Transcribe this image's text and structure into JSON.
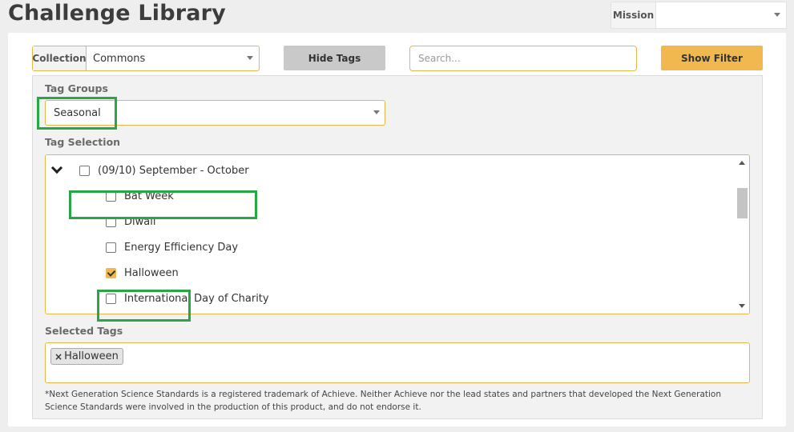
{
  "page": {
    "title": "Challenge Library"
  },
  "mission": {
    "label": "Mission",
    "value": ""
  },
  "toolbar": {
    "collection_label": "Collection",
    "collection_value": "Commons",
    "hide_tags_label": "Hide Tags",
    "search_placeholder": "Search...",
    "show_filter_label": "Show Filter"
  },
  "tag_groups": {
    "label": "Tag Groups",
    "value": "Seasonal"
  },
  "tag_selection": {
    "label": "Tag Selection",
    "parent": {
      "label": "(09/10) September - October",
      "checked": false,
      "expanded": true
    },
    "items": [
      {
        "label": "Bat Week",
        "checked": false
      },
      {
        "label": "Diwali",
        "checked": false
      },
      {
        "label": "Energy Efficiency Day",
        "checked": false
      },
      {
        "label": "Halloween",
        "checked": true
      },
      {
        "label": "International Day of Charity",
        "checked": false
      }
    ]
  },
  "selected_tags": {
    "label": "Selected Tags",
    "chips": [
      {
        "remove": "×",
        "label": "Halloween"
      }
    ]
  },
  "footnote": "*Next Generation Science Standards is a registered trademark of Achieve. Neither Achieve nor the lead states and partners that developed the Next Generation Science Standards were involved in the production of this product, and do not endorse it.",
  "colors": {
    "accent": "#f0b84e",
    "border": "#e8b64a",
    "highlight": "#29a745",
    "button_gray": "#c9c9c9"
  }
}
